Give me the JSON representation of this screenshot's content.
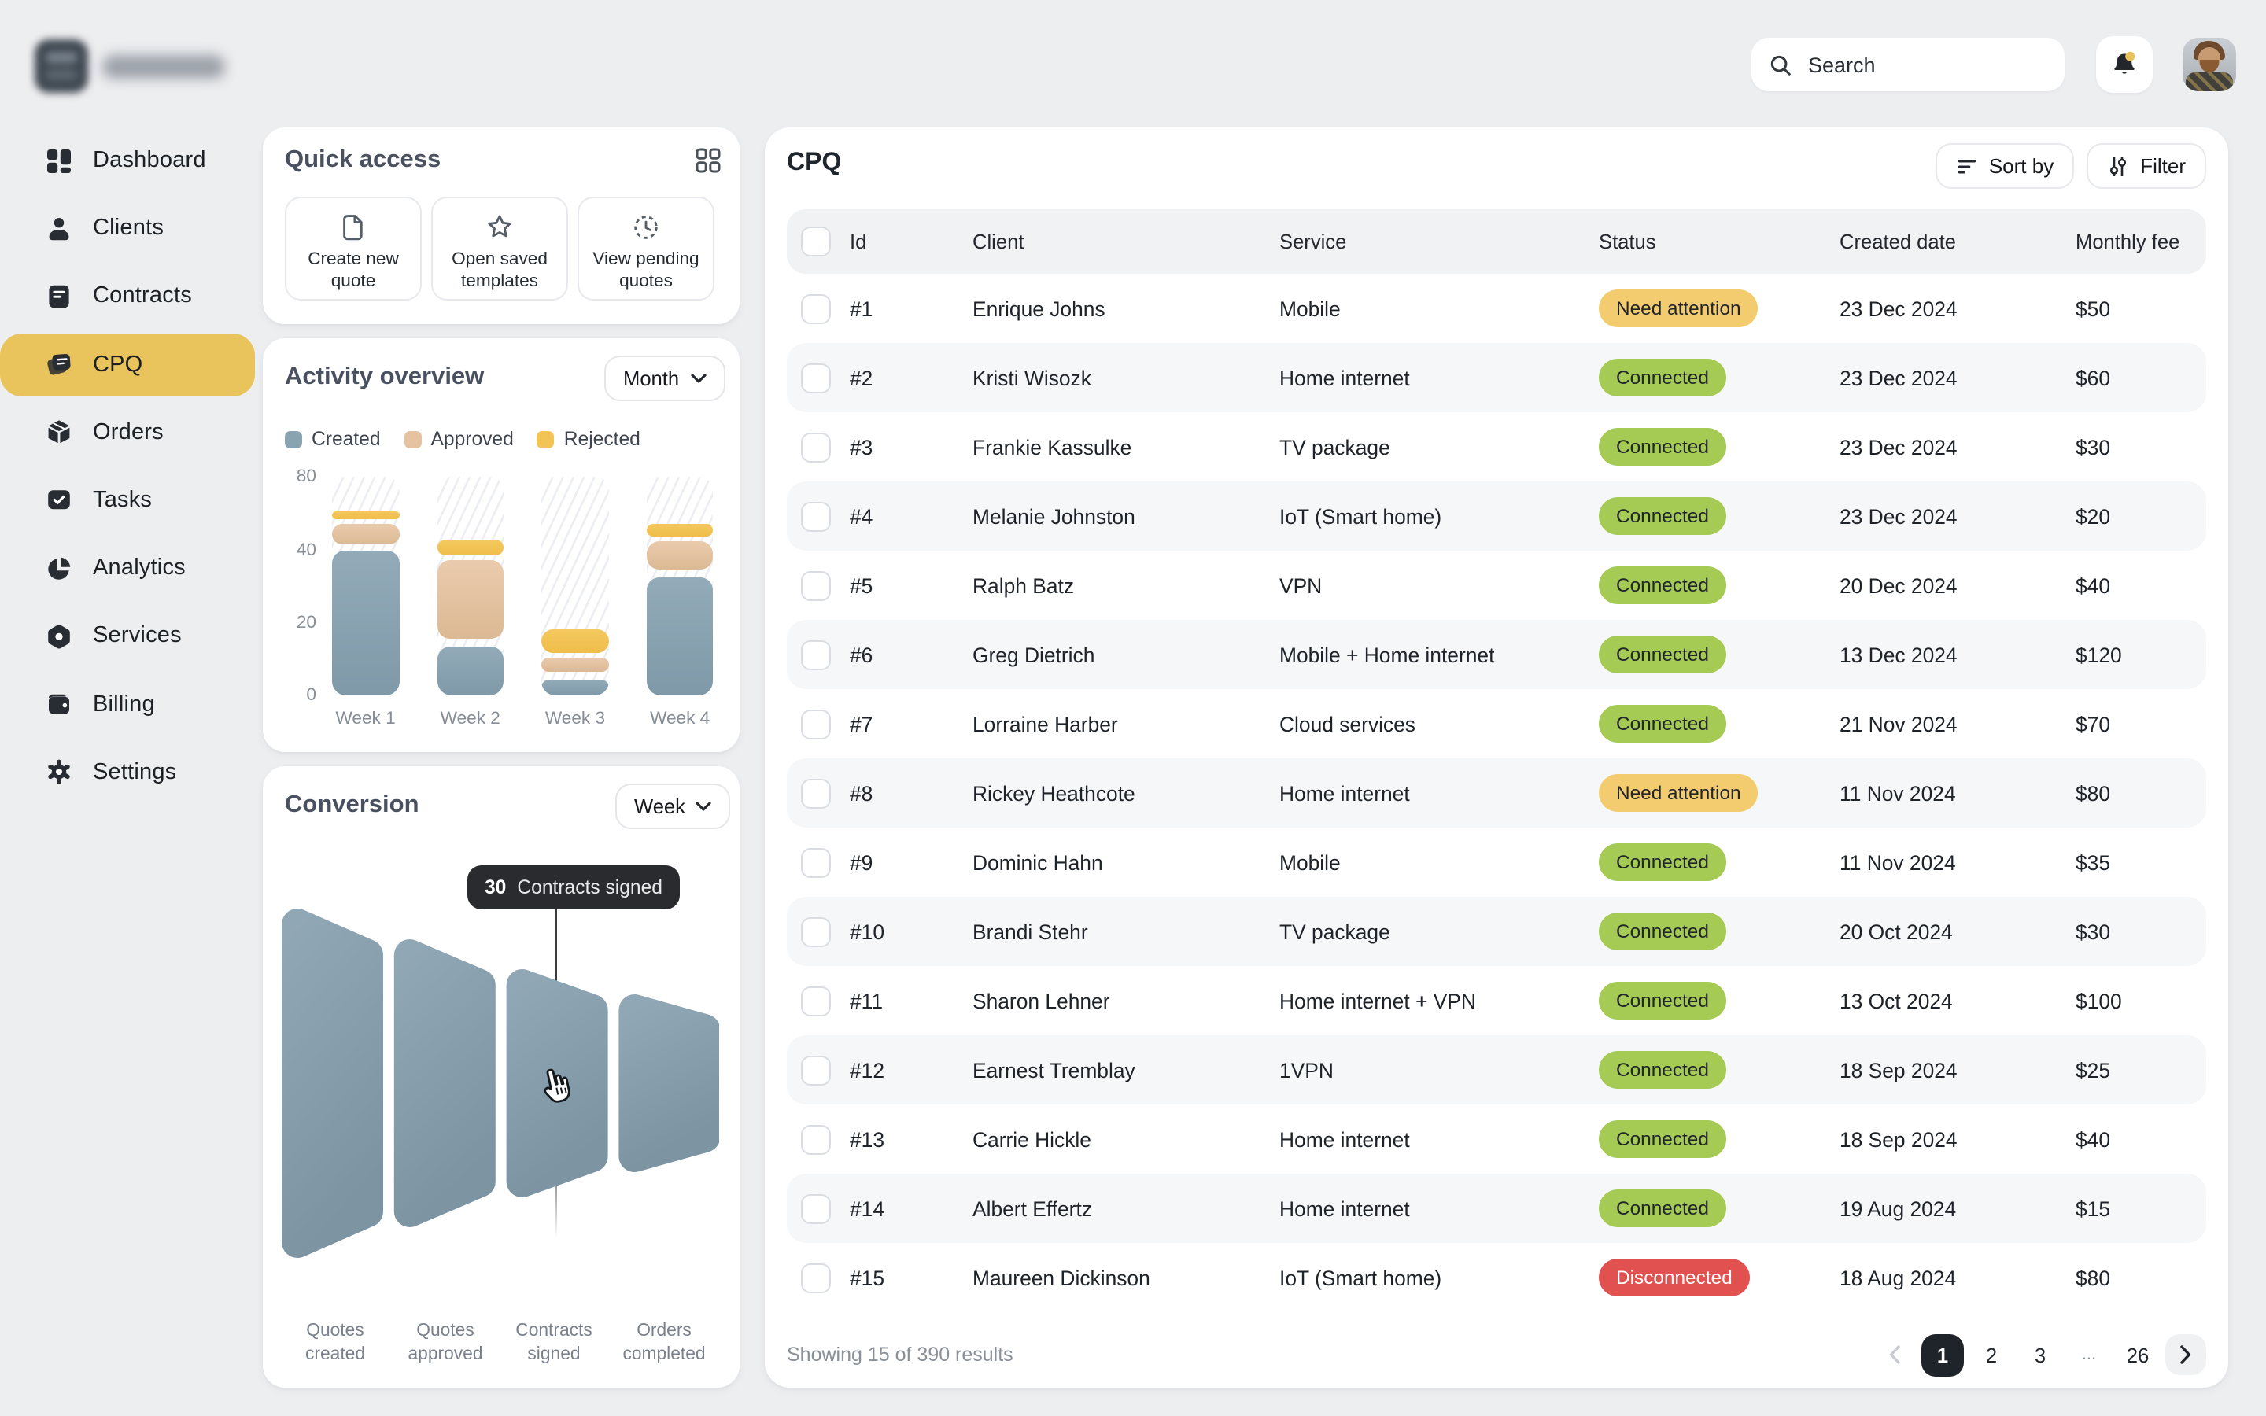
{
  "header": {
    "search_placeholder": "Search"
  },
  "sidebar": {
    "items": [
      {
        "label": "Dashboard",
        "icon": "dashboard",
        "active": false
      },
      {
        "label": "Clients",
        "icon": "clients",
        "active": false
      },
      {
        "label": "Contracts",
        "icon": "contracts",
        "active": false
      },
      {
        "label": "CPQ",
        "icon": "cpq",
        "active": true
      },
      {
        "label": "Orders",
        "icon": "orders",
        "active": false
      },
      {
        "label": "Tasks",
        "icon": "tasks",
        "active": false
      },
      {
        "label": "Analytics",
        "icon": "analytics",
        "active": false
      },
      {
        "label": "Services",
        "icon": "services",
        "active": false
      },
      {
        "label": "Billing",
        "icon": "billing",
        "active": false
      },
      {
        "label": "Settings",
        "icon": "settings",
        "active": false
      }
    ]
  },
  "quick_access": {
    "title": "Quick access",
    "actions": [
      {
        "label": "Create new quote",
        "icon": "file"
      },
      {
        "label": "Open saved templates",
        "icon": "star"
      },
      {
        "label": "View pending quotes",
        "icon": "clock"
      }
    ]
  },
  "activity": {
    "title": "Activity overview",
    "period": "Month"
  },
  "conversion": {
    "title": "Conversion",
    "period": "Week",
    "tooltip": {
      "value": "30",
      "label": "Contracts signed"
    }
  },
  "chart_data": [
    {
      "type": "bar",
      "stacked": true,
      "title": "Activity overview",
      "categories": [
        "Week 1",
        "Week 2",
        "Week 3",
        "Week 4"
      ],
      "series": [
        {
          "name": "Created",
          "color": "#8AA3B1",
          "values": [
            42,
            15,
            6,
            34
          ]
        },
        {
          "name": "Approved",
          "color": "#E5C2A0",
          "values": [
            14,
            23,
            5,
            12
          ]
        },
        {
          "name": "Rejected",
          "color": "#F1C455",
          "values": [
            7,
            9,
            8,
            10
          ]
        }
      ],
      "y_ticks": [
        0,
        20,
        40,
        80
      ],
      "ymax": 80,
      "grid": false,
      "legend_position": "top"
    },
    {
      "type": "funnel",
      "title": "Conversion",
      "stages": [
        {
          "label": "Quotes created",
          "value": null
        },
        {
          "label": "Quotes approved",
          "value": null
        },
        {
          "label": "Contracts signed",
          "value": 30
        },
        {
          "label": "Orders completed",
          "value": null
        }
      ],
      "tooltip": {
        "value": 30,
        "label": "Contracts signed"
      }
    }
  ],
  "table": {
    "title": "CPQ",
    "sort_label": "Sort by",
    "filter_label": "Filter",
    "columns": [
      "Id",
      "Client",
      "Service",
      "Status",
      "Created date",
      "Monthly fee"
    ],
    "rows": [
      {
        "id": "#1",
        "client": "Enrique Johns",
        "service": "Mobile",
        "status": "Need attention",
        "status_type": "warning",
        "date": "23 Dec 2024",
        "fee": "$50"
      },
      {
        "id": "#2",
        "client": "Kristi Wisozk",
        "service": "Home internet",
        "status": "Connected",
        "status_type": "ok",
        "date": "23 Dec 2024",
        "fee": "$60"
      },
      {
        "id": "#3",
        "client": "Frankie Kassulke",
        "service": "TV package",
        "status": "Connected",
        "status_type": "ok",
        "date": "23 Dec 2024",
        "fee": "$30"
      },
      {
        "id": "#4",
        "client": "Melanie Johnston",
        "service": "IoT (Smart home)",
        "status": "Connected",
        "status_type": "ok",
        "date": "23 Dec 2024",
        "fee": "$20"
      },
      {
        "id": "#5",
        "client": "Ralph Batz",
        "service": "VPN",
        "status": "Connected",
        "status_type": "ok",
        "date": "20 Dec 2024",
        "fee": "$40"
      },
      {
        "id": "#6",
        "client": "Greg Dietrich",
        "service": "Mobile + Home internet",
        "status": "Connected",
        "status_type": "ok",
        "date": "13 Dec 2024",
        "fee": "$120"
      },
      {
        "id": "#7",
        "client": "Lorraine Harber",
        "service": "Cloud services",
        "status": "Connected",
        "status_type": "ok",
        "date": "21 Nov 2024",
        "fee": "$70"
      },
      {
        "id": "#8",
        "client": "Rickey Heathcote",
        "service": "Home internet",
        "status": "Need attention",
        "status_type": "warning",
        "date": "11 Nov 2024",
        "fee": "$80"
      },
      {
        "id": "#9",
        "client": "Dominic Hahn",
        "service": "Mobile",
        "status": "Connected",
        "status_type": "ok",
        "date": "11 Nov 2024",
        "fee": "$35"
      },
      {
        "id": "#10",
        "client": "Brandi Stehr",
        "service": "TV package",
        "status": "Connected",
        "status_type": "ok",
        "date": "20 Oct 2024",
        "fee": "$30"
      },
      {
        "id": "#11",
        "client": "Sharon Lehner",
        "service": "Home internet + VPN",
        "status": "Connected",
        "status_type": "ok",
        "date": "13 Oct 2024",
        "fee": "$100"
      },
      {
        "id": "#12",
        "client": "Earnest Tremblay",
        "service": "1VPN",
        "status": "Connected",
        "status_type": "ok",
        "date": "18 Sep 2024",
        "fee": "$25"
      },
      {
        "id": "#13",
        "client": "Carrie Hickle",
        "service": "Home internet",
        "status": "Connected",
        "status_type": "ok",
        "date": "18 Sep 2024",
        "fee": "$40"
      },
      {
        "id": "#14",
        "client": "Albert Effertz",
        "service": "Home internet",
        "status": "Connected",
        "status_type": "ok",
        "date": "19 Aug 2024",
        "fee": "$15"
      },
      {
        "id": "#15",
        "client": "Maureen Dickinson",
        "service": "IoT (Smart home)",
        "status": "Disconnected",
        "status_type": "error",
        "date": "18 Aug 2024",
        "fee": "$80"
      }
    ],
    "footer": {
      "summary": "Showing 15 of 390 results",
      "pages": [
        "1",
        "2",
        "3",
        "...",
        "26"
      ],
      "active_page": "1"
    }
  },
  "colors": {
    "accent_yellow": "#E9C35B",
    "badge_green": "#A5CB55",
    "badge_amber": "#F3CC6F",
    "badge_red": "#E15150",
    "funnel_blue": "#87A0AE",
    "page_bg": "#EDEEF0"
  }
}
